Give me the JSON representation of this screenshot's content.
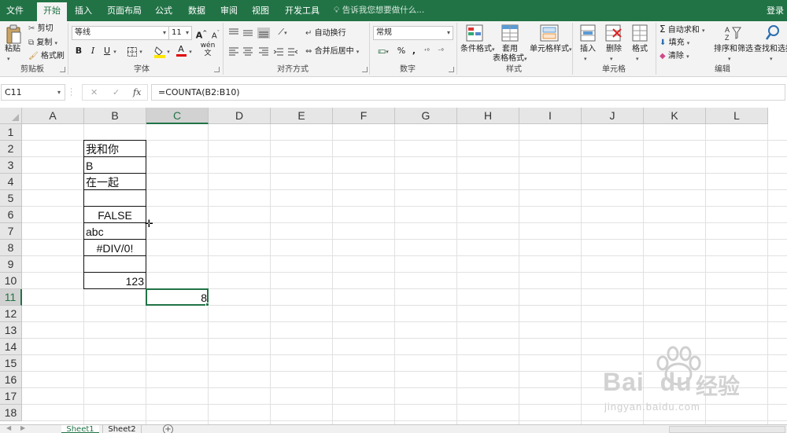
{
  "ribbon_tabs": [
    {
      "label": "文件",
      "active": false
    },
    {
      "label": "开始",
      "active": true
    },
    {
      "label": "插入",
      "active": false
    },
    {
      "label": "页面布局",
      "active": false
    },
    {
      "label": "公式",
      "active": false
    },
    {
      "label": "数据",
      "active": false
    },
    {
      "label": "审阅",
      "active": false
    },
    {
      "label": "视图",
      "active": false
    },
    {
      "label": "开发工具",
      "active": false
    }
  ],
  "tell_me": {
    "icon": "lightbulb-icon",
    "text": "告诉我您想要做什么..."
  },
  "login_label": "登录",
  "clipboard": {
    "paste_label": "粘贴",
    "cut_label": "剪切",
    "copy_label": "复制",
    "format_painter_label": "格式刷",
    "group_label": "剪贴板"
  },
  "font_group": {
    "font_name": "等线",
    "font_size": "11",
    "grow_label": "A",
    "shrink_label": "A",
    "bold": "B",
    "italic": "I",
    "underline": "U",
    "font_color_label": "A",
    "phonetic_label": "wén",
    "group_label": "字体"
  },
  "alignment": {
    "wrap_text_label": "自动换行",
    "merge_center_label": "合并后居中",
    "group_label": "对齐方式"
  },
  "number": {
    "format": "常规",
    "percent_label": "%",
    "comma_label": ",",
    "group_label": "数字"
  },
  "styles": {
    "conditional_label": "条件格式",
    "table_label_line1": "套用",
    "table_label_line2": "表格格式",
    "cell_styles_label": "单元格样式",
    "group_label": "样式"
  },
  "cells_group": {
    "insert_label": "插入",
    "delete_label": "删除",
    "format_label": "格式",
    "group_label": "单元格"
  },
  "editing": {
    "autosum_label": "自动求和",
    "fill_label": "填充",
    "clear_label": "清除",
    "sort_filter_label": "排序和筛选",
    "find_select_label": "查找和选择",
    "group_label": "编辑"
  },
  "formula_bar": {
    "name_box": "C11",
    "cancel": "✕",
    "enter": "✓",
    "fx": "fx",
    "formula": "=COUNTA(B2:B10)"
  },
  "grid": {
    "columns": [
      "A",
      "B",
      "C",
      "D",
      "E",
      "F",
      "G",
      "H",
      "I",
      "J",
      "K",
      "L"
    ],
    "rows": [
      "1",
      "2",
      "3",
      "4",
      "5",
      "6",
      "7",
      "8",
      "9",
      "10",
      "11",
      "12",
      "13",
      "14",
      "15",
      "16",
      "17",
      "18"
    ],
    "selected_column": "C",
    "selected_row": "11",
    "cells": {
      "B2": "我和你",
      "B3": "B",
      "B4": "在一起",
      "B5": "",
      "B6": "FALSE",
      "B7": "abc",
      "B8": "#DIV/0!",
      "B9": "",
      "B10": "123",
      "C11": "8"
    }
  },
  "sheets": [
    {
      "label": "Sheet1",
      "active": true
    },
    {
      "label": "Sheet2",
      "active": false
    }
  ],
  "add_sheet_label": "+",
  "watermark": {
    "brand": "Bai",
    "brand_du": "du",
    "brand_cn": "经验",
    "url": "jingyan.baidu.com"
  },
  "colors": {
    "accent": "#217346",
    "grid_line": "#e1e1e1",
    "header_bg": "#e6e6e6"
  }
}
